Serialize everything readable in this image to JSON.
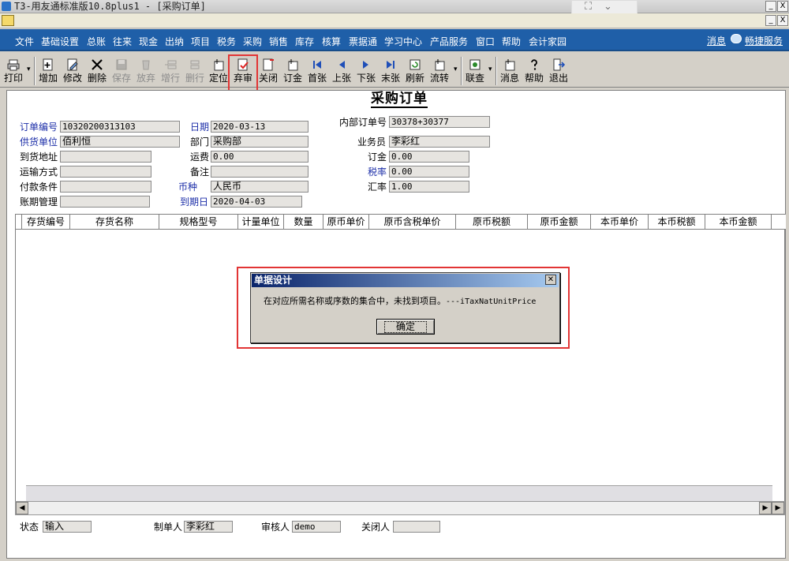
{
  "window": {
    "title": "T3-用友通标准版10.8plus1 - [采购订单]",
    "min_label": "_",
    "close_label": "X"
  },
  "menu": {
    "items": [
      "文件",
      "基础设置",
      "总账",
      "往来",
      "现金",
      "出纳",
      "项目",
      "税务",
      "采购",
      "销售",
      "库存",
      "核算",
      "票据通",
      "学习中心",
      "产品服务",
      "窗口",
      "帮助",
      "会计家园"
    ],
    "right_links": [
      "消息",
      "畅捷服务"
    ]
  },
  "toolbar": {
    "buttons": [
      {
        "label": "打印",
        "icon": "printer-icon",
        "enabled": true
      },
      {
        "label": "增加",
        "icon": "add-icon",
        "enabled": true
      },
      {
        "label": "修改",
        "icon": "edit-icon",
        "enabled": true
      },
      {
        "label": "删除",
        "icon": "delete-icon",
        "enabled": true
      },
      {
        "label": "保存",
        "icon": "save-icon",
        "enabled": false
      },
      {
        "label": "放弃",
        "icon": "discard-icon",
        "enabled": false
      },
      {
        "label": "增行",
        "icon": "add-row-icon",
        "enabled": false
      },
      {
        "label": "删行",
        "icon": "delete-row-icon",
        "enabled": false
      },
      {
        "label": "定位",
        "icon": "locate-icon",
        "enabled": true
      },
      {
        "label": "弃审",
        "icon": "unapprove-icon",
        "enabled": true
      },
      {
        "label": "关闭",
        "icon": "close-doc-icon",
        "enabled": true
      },
      {
        "label": "订金",
        "icon": "deposit-icon",
        "enabled": true
      },
      {
        "label": "首张",
        "icon": "first-icon",
        "enabled": true
      },
      {
        "label": "上张",
        "icon": "prev-icon",
        "enabled": true
      },
      {
        "label": "下张",
        "icon": "next-icon",
        "enabled": true
      },
      {
        "label": "末张",
        "icon": "last-icon",
        "enabled": true
      },
      {
        "label": "刷新",
        "icon": "refresh-icon",
        "enabled": true
      },
      {
        "label": "流转",
        "icon": "flow-icon",
        "enabled": true
      },
      {
        "label": "联查",
        "icon": "query-icon",
        "enabled": true
      },
      {
        "label": "消息",
        "icon": "message-icon",
        "enabled": true
      },
      {
        "label": "帮助",
        "icon": "help-icon",
        "enabled": true
      },
      {
        "label": "退出",
        "icon": "exit-icon",
        "enabled": true
      }
    ],
    "dropdown_arrow": "▾"
  },
  "form": {
    "title": "采购订单",
    "fields": {
      "order_no": {
        "label": "订单编号",
        "value": "10320200313103"
      },
      "date": {
        "label": "日期",
        "value": "2020-03-13"
      },
      "internal_no": {
        "label": "内部订单号",
        "value": "30378+30377"
      },
      "supplier": {
        "label": "供货单位",
        "value": "佰利恒"
      },
      "department": {
        "label": "部门",
        "value": "采购部"
      },
      "salesperson": {
        "label": "业务员",
        "value": "李彩红"
      },
      "delivery_addr": {
        "label": "到货地址",
        "value": ""
      },
      "freight": {
        "label": "运费",
        "value": "0.00"
      },
      "deposit": {
        "label": "订金",
        "value": "0.00"
      },
      "transport": {
        "label": "运输方式",
        "value": ""
      },
      "remark": {
        "label": "备注",
        "value": ""
      },
      "tax_rate": {
        "label": "税率",
        "value": "0.00"
      },
      "payment_terms": {
        "label": "付款条件",
        "value": ""
      },
      "currency": {
        "label": "币种",
        "value": "人民币"
      },
      "exchange_rate": {
        "label": "汇率",
        "value": "1.00"
      },
      "account_period": {
        "label": "账期管理",
        "value": ""
      },
      "due_date": {
        "label": "到期日",
        "value": "2020-04-03"
      }
    },
    "grid_columns": [
      "存货编号",
      "存货名称",
      "规格型号",
      "计量单位",
      "数量",
      "原币单价",
      "原币含税单价",
      "原币税额",
      "原币金额",
      "本币单价",
      "本币税额",
      "本币金额"
    ],
    "status": {
      "state": {
        "label": "状态",
        "value": "输入"
      },
      "maker": {
        "label": "制单人",
        "value": "李彩红"
      },
      "auditor": {
        "label": "审核人",
        "value": "demo"
      },
      "closer": {
        "label": "关闭人",
        "value": ""
      }
    }
  },
  "dialog": {
    "title": "单据设计",
    "message": "在对应所需名称或序数的集合中，未找到项目。",
    "message_code": "---iTaxNatUnitPrice",
    "ok_label": "确定",
    "close_label": "✕"
  },
  "colors": {
    "menubar": "#1f5fa8",
    "highlight": "#e23535",
    "dialog_title": "#0a246a"
  }
}
